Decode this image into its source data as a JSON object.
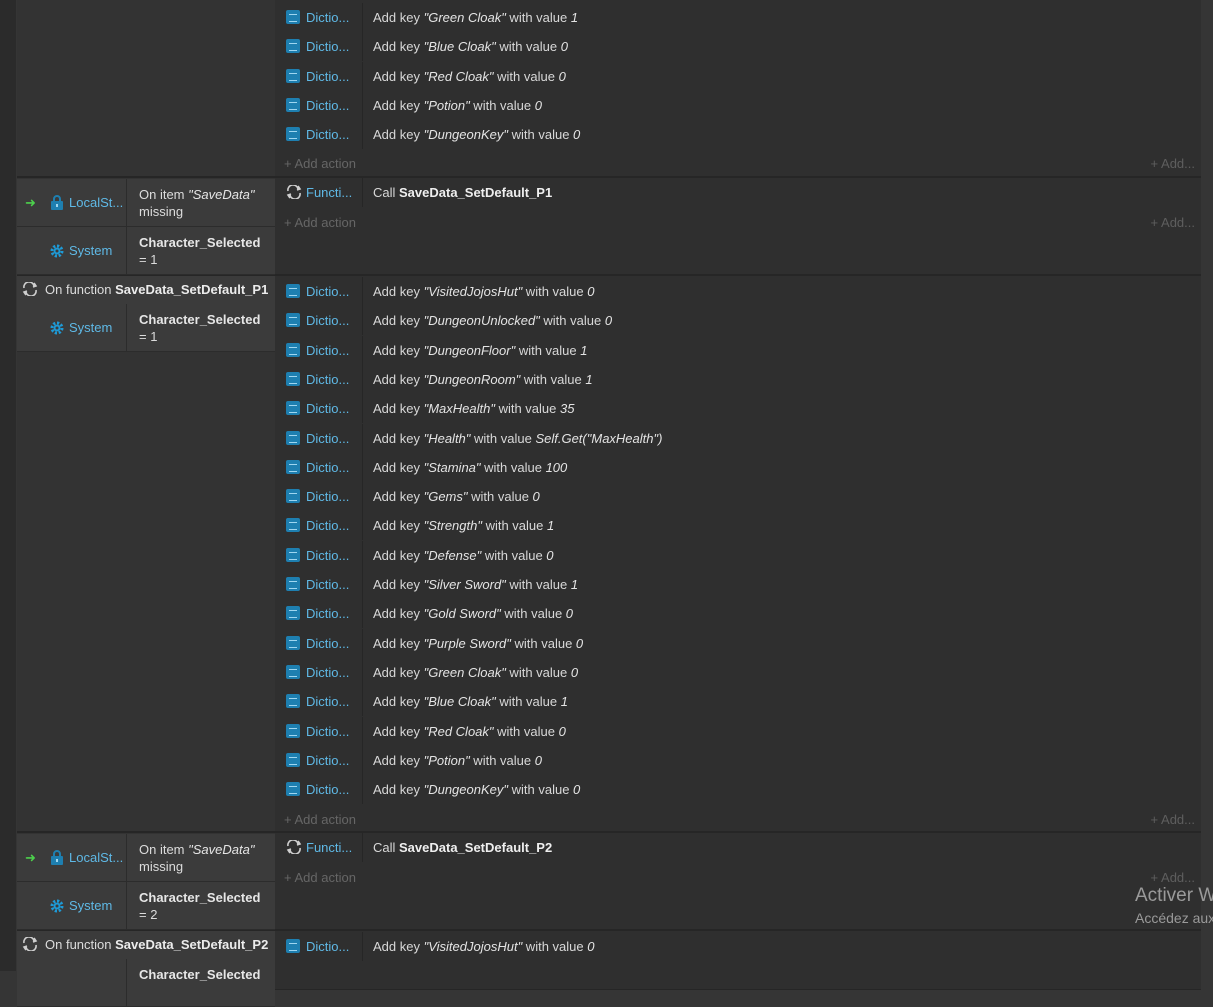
{
  "colors": {
    "accent": "#5fb9e6",
    "trigger": "#4cd04c",
    "background": "#353535"
  },
  "block1": {
    "actions": [
      {
        "object": "Dictio...",
        "icon": "dictionary-icon",
        "pre": "Add key ",
        "key": "\"Green Cloak\"",
        "mid": " with value ",
        "value": "1"
      },
      {
        "object": "Dictio...",
        "icon": "dictionary-icon",
        "pre": "Add key ",
        "key": "\"Blue Cloak\"",
        "mid": " with value ",
        "value": "0"
      },
      {
        "object": "Dictio...",
        "icon": "dictionary-icon",
        "pre": "Add key ",
        "key": "\"Red Cloak\"",
        "mid": " with value ",
        "value": "0"
      },
      {
        "object": "Dictio...",
        "icon": "dictionary-icon",
        "pre": "Add key ",
        "key": "\"Potion\"",
        "mid": " with value ",
        "value": "0"
      },
      {
        "object": "Dictio...",
        "icon": "dictionary-icon",
        "pre": "Add key ",
        "key": "\"DungeonKey\"",
        "mid": " with value ",
        "value": "0"
      }
    ],
    "add_action": "+ Add action",
    "add_more": "+ Add..."
  },
  "event2": {
    "trigger_arrow": "➜",
    "cond1_object": "LocalSt...",
    "cond1_pre": "On item ",
    "cond1_item": "\"SaveData\"",
    "cond1_post": " missing",
    "cond2_object": "System",
    "cond2_var": "Character_Selected",
    "cond2_op": " = 1",
    "action_object": "Functi...",
    "action_pre": "Call ",
    "action_fn": "SaveData_SetDefault_P1",
    "add_action": "+ Add action",
    "add_more": "+ Add..."
  },
  "function_p1": {
    "head_pre": "On function ",
    "head_name": "SaveData_SetDefault_P1",
    "cond_object": "System",
    "cond_var": "Character_Selected",
    "cond_op": " = 1",
    "actions": [
      {
        "object": "Dictio...",
        "icon": "dictionary-icon",
        "pre": "Add key ",
        "key": "\"VisitedJojosHut\"",
        "mid": " with value ",
        "value": "0"
      },
      {
        "object": "Dictio...",
        "icon": "dictionary-icon",
        "pre": "Add key ",
        "key": "\"DungeonUnlocked\"",
        "mid": " with value ",
        "value": "0"
      },
      {
        "object": "Dictio...",
        "icon": "dictionary-icon",
        "pre": "Add key ",
        "key": "\"DungeonFloor\"",
        "mid": " with value ",
        "value": "1"
      },
      {
        "object": "Dictio...",
        "icon": "dictionary-icon",
        "pre": "Add key ",
        "key": "\"DungeonRoom\"",
        "mid": " with value ",
        "value": "1"
      },
      {
        "object": "Dictio...",
        "icon": "dictionary-icon",
        "pre": "Add key ",
        "key": "\"MaxHealth\"",
        "mid": " with value ",
        "value": "35"
      },
      {
        "object": "Dictio...",
        "icon": "dictionary-icon",
        "pre": "Add key ",
        "key": "\"Health\"",
        "mid": " with value ",
        "value": "Self.Get(\"MaxHealth\")"
      },
      {
        "object": "Dictio...",
        "icon": "dictionary-icon",
        "pre": "Add key ",
        "key": "\"Stamina\"",
        "mid": " with value ",
        "value": "100"
      },
      {
        "object": "Dictio...",
        "icon": "dictionary-icon",
        "pre": "Add key ",
        "key": "\"Gems\"",
        "mid": " with value ",
        "value": "0"
      },
      {
        "object": "Dictio...",
        "icon": "dictionary-icon",
        "pre": "Add key ",
        "key": "\"Strength\"",
        "mid": " with value ",
        "value": "1"
      },
      {
        "object": "Dictio...",
        "icon": "dictionary-icon",
        "pre": "Add key ",
        "key": "\"Defense\"",
        "mid": " with value ",
        "value": "0"
      },
      {
        "object": "Dictio...",
        "icon": "dictionary-icon",
        "pre": "Add key ",
        "key": "\"Silver Sword\"",
        "mid": " with value ",
        "value": "1"
      },
      {
        "object": "Dictio...",
        "icon": "dictionary-icon",
        "pre": "Add key ",
        "key": "\"Gold Sword\"",
        "mid": " with value ",
        "value": "0"
      },
      {
        "object": "Dictio...",
        "icon": "dictionary-icon",
        "pre": "Add key ",
        "key": "\"Purple Sword\"",
        "mid": " with value ",
        "value": "0"
      },
      {
        "object": "Dictio...",
        "icon": "dictionary-icon",
        "pre": "Add key ",
        "key": "\"Green Cloak\"",
        "mid": " with value ",
        "value": "0"
      },
      {
        "object": "Dictio...",
        "icon": "dictionary-icon",
        "pre": "Add key ",
        "key": "\"Blue Cloak\"",
        "mid": " with value ",
        "value": "1"
      },
      {
        "object": "Dictio...",
        "icon": "dictionary-icon",
        "pre": "Add key ",
        "key": "\"Red Cloak\"",
        "mid": " with value ",
        "value": "0"
      },
      {
        "object": "Dictio...",
        "icon": "dictionary-icon",
        "pre": "Add key ",
        "key": "\"Potion\"",
        "mid": " with value ",
        "value": "0"
      },
      {
        "object": "Dictio...",
        "icon": "dictionary-icon",
        "pre": "Add key ",
        "key": "\"DungeonKey\"",
        "mid": " with value ",
        "value": "0"
      }
    ],
    "add_action": "+ Add action",
    "add_more": "+ Add..."
  },
  "event3": {
    "trigger_arrow": "➜",
    "cond1_object": "LocalSt...",
    "cond1_pre": "On item ",
    "cond1_item": "\"SaveData\"",
    "cond1_post": " missing",
    "cond2_object": "System",
    "cond2_var": "Character_Selected",
    "cond2_op": " = 2",
    "action_object": "Functi...",
    "action_pre": "Call ",
    "action_fn": "SaveData_SetDefault_P2",
    "add_action": "+ Add action",
    "add_more": "+ Add..."
  },
  "function_p2": {
    "head_pre": "On function ",
    "head_name": "SaveData_SetDefault_P2",
    "cond_var": "Character_Selected",
    "actions": [
      {
        "object": "Dictio...",
        "icon": "dictionary-icon",
        "pre": "Add key ",
        "key": "\"VisitedJojosHut\"",
        "mid": " with value ",
        "value": "0"
      }
    ]
  },
  "watermark": {
    "line1": "Activer W",
    "line2": "Accédez aux"
  }
}
